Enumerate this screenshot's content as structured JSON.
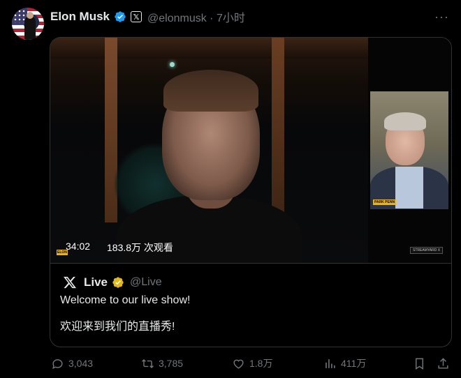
{
  "author": {
    "name": "Elon Musk",
    "x_badge": "𝕏",
    "handle_time": "@elonmusk · 7小时"
  },
  "more_label": "···",
  "video": {
    "duration": "34:02",
    "views": "183.8万 次观看",
    "inset_tag": "PARK PENN",
    "stream_label": "STREAMYARD  X",
    "corner_logo": "ELON"
  },
  "quote": {
    "name": "Live",
    "handle": "@Live",
    "text_en": "Welcome to our live show!",
    "text_zh": "欢迎来到我们的直播秀!"
  },
  "actions": {
    "replies": "3,043",
    "reposts": "3,785",
    "likes": "1.8万",
    "views": "411万"
  },
  "colors": {
    "verified_blue": "#1d9bf0",
    "verified_gold": "#e2b719",
    "muted": "#71767b"
  }
}
